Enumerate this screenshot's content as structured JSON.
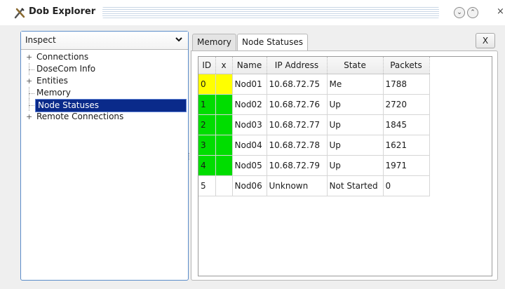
{
  "window": {
    "title": "Dob Explorer",
    "buttons": {
      "minimize": "⌄",
      "maximize": "⌃",
      "close": "×"
    }
  },
  "left_panel": {
    "combo_value": "Inspect",
    "tree": [
      {
        "label": "Connections",
        "expander": "+",
        "level": 0,
        "selected": false
      },
      {
        "label": "DoseCom Info",
        "expander": "",
        "level": 1,
        "selected": false
      },
      {
        "label": "Entities",
        "expander": "+",
        "level": 0,
        "selected": false
      },
      {
        "label": "Memory",
        "expander": "",
        "level": 1,
        "selected": false
      },
      {
        "label": "Node Statuses",
        "expander": "",
        "level": 1,
        "selected": true
      },
      {
        "label": "Remote Connections",
        "expander": "+",
        "level": 0,
        "selected": false
      }
    ]
  },
  "tabs": [
    {
      "label": "Memory",
      "active": false
    },
    {
      "label": "Node Statuses",
      "active": true
    }
  ],
  "close_tab_label": "X",
  "table": {
    "columns": [
      "ID",
      "x",
      "Name",
      "IP Address",
      "State",
      "Packets"
    ],
    "rows": [
      {
        "id": "0",
        "color": "#ffff00",
        "name": "Nod01",
        "ip": "10.68.72.75",
        "state": "Me",
        "packets": "1788"
      },
      {
        "id": "1",
        "color": "#00dd00",
        "name": "Nod02",
        "ip": "10.68.72.76",
        "state": "Up",
        "packets": "2720"
      },
      {
        "id": "2",
        "color": "#00dd00",
        "name": "Nod03",
        "ip": "10.68.72.77",
        "state": "Up",
        "packets": "1845"
      },
      {
        "id": "3",
        "color": "#00dd00",
        "name": "Nod04",
        "ip": "10.68.72.78",
        "state": "Up",
        "packets": "1621"
      },
      {
        "id": "4",
        "color": "#00dd00",
        "name": "Nod05",
        "ip": "10.68.72.79",
        "state": "Up",
        "packets": "1971"
      },
      {
        "id": "5",
        "color": "#ffffff",
        "name": "Nod06",
        "ip": "Unknown",
        "state": "Not Started",
        "packets": "0"
      }
    ]
  },
  "colors": {
    "accent": "#5b8cc9",
    "selection": "#0a2a8a",
    "status_me": "#ffff00",
    "status_up": "#00dd00"
  }
}
